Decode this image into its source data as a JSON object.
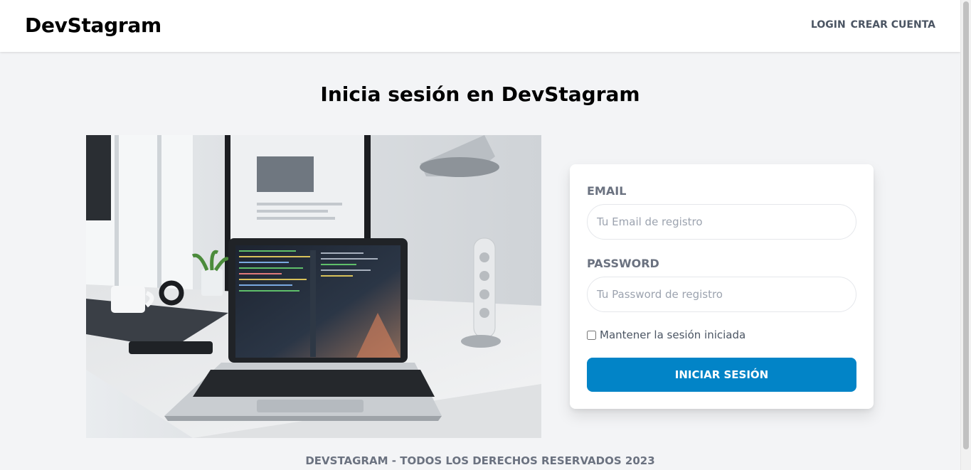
{
  "header": {
    "logo": "DevStagram",
    "nav": {
      "login": "LOGIN",
      "register": "CREAR CUENTA"
    }
  },
  "main": {
    "title": "Inicia sesión en DevStagram",
    "image_alt": "Laptop on desk with code editor",
    "form": {
      "email_label": "EMAIL",
      "email_placeholder": "Tu Email de registro",
      "email_value": "",
      "password_label": "PASSWORD",
      "password_placeholder": "Tu Password de registro",
      "password_value": "",
      "remember_label": "Mantener la sesión iniciada",
      "remember_checked": false,
      "submit_label": "INICIAR SESIÓN"
    }
  },
  "footer": {
    "text": "DEVSTAGRAM - TODOS LOS DERECHOS RESERVADOS 2023"
  },
  "colors": {
    "page_background": "#f3f4f6",
    "primary_button": "#0284c7",
    "label_text": "#6b7280"
  }
}
